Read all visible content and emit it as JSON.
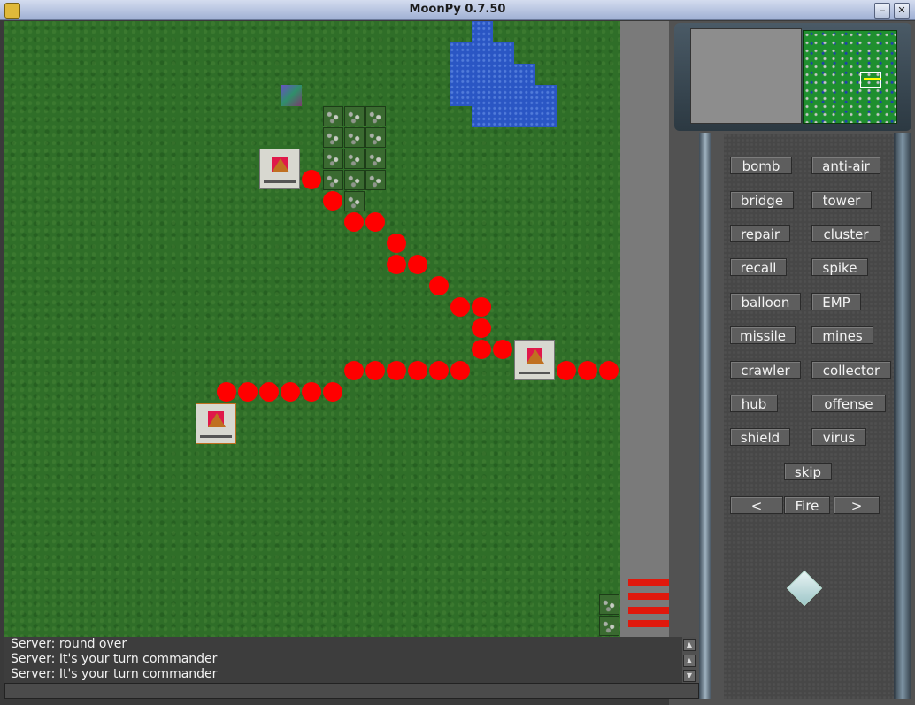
{
  "window": {
    "title": "MoonPy 0.7.50",
    "minimize_label": "‒",
    "close_label": "✕"
  },
  "weapons": {
    "col1": [
      "bomb",
      "bridge",
      "repair",
      "recall",
      "balloon",
      "missile",
      "crawler",
      "hub",
      "shield"
    ],
    "col2": [
      "anti-air",
      "tower",
      "cluster",
      "spike",
      "EMP",
      "mines",
      "collector",
      "offense",
      "virus"
    ],
    "skip": "skip",
    "prev": "<",
    "fire": "Fire",
    "next": ">"
  },
  "log": {
    "lines": [
      "Server: round over",
      "Server: It's your turn commander",
      "Server: It's your turn commander"
    ]
  },
  "game": {
    "shot_path_color": "#ff0000",
    "energy_bars": 4
  }
}
